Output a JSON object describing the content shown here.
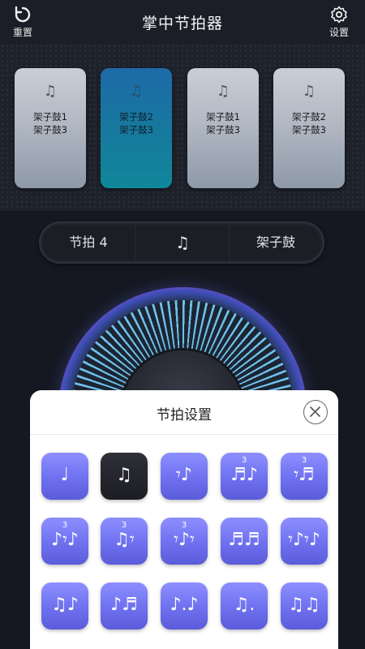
{
  "topbar": {
    "reset_label": "重置",
    "title": "掌中节拍器",
    "settings_label": "设置"
  },
  "beat_cards": [
    {
      "note": "♫",
      "line1": "架子鼓1",
      "line2": "架子鼓3",
      "active": false
    },
    {
      "note": "♫",
      "line1": "架子鼓2",
      "line2": "架子鼓3",
      "active": true
    },
    {
      "note": "♫",
      "line1": "架子鼓1",
      "line2": "架子鼓3",
      "active": false
    },
    {
      "note": "♫",
      "line1": "架子鼓2",
      "line2": "架子鼓3",
      "active": false
    }
  ],
  "controls": {
    "beat_label": "节拍 4",
    "rhythm_icon": "♫",
    "sound_label": "架子鼓"
  },
  "dialog": {
    "title": "节拍设置",
    "rhythms": [
      {
        "glyph": "♩",
        "sub": "",
        "selected": false
      },
      {
        "glyph": "♫",
        "sub": "",
        "selected": true
      },
      {
        "glyph": "𝄾♪",
        "sub": "",
        "selected": false
      },
      {
        "glyph": "♬♪",
        "sub": "3",
        "selected": false
      },
      {
        "glyph": "𝄾♬",
        "sub": "3",
        "selected": false
      },
      {
        "glyph": "♪𝄾♪",
        "sub": "3",
        "selected": false
      },
      {
        "glyph": "♫𝄾",
        "sub": "3",
        "selected": false
      },
      {
        "glyph": "𝄾♪𝄾",
        "sub": "3",
        "selected": false
      },
      {
        "glyph": "♬♬",
        "sub": "",
        "selected": false
      },
      {
        "glyph": "𝄾♪𝄾♪",
        "sub": "",
        "selected": false
      },
      {
        "glyph": "♫♪",
        "sub": "",
        "selected": false
      },
      {
        "glyph": "♪♬",
        "sub": "",
        "selected": false
      },
      {
        "glyph": "♪.♪",
        "sub": "",
        "selected": false
      },
      {
        "glyph": "♫.",
        "sub": "",
        "selected": false
      },
      {
        "glyph": "♫♫",
        "sub": "",
        "selected": false
      }
    ]
  }
}
